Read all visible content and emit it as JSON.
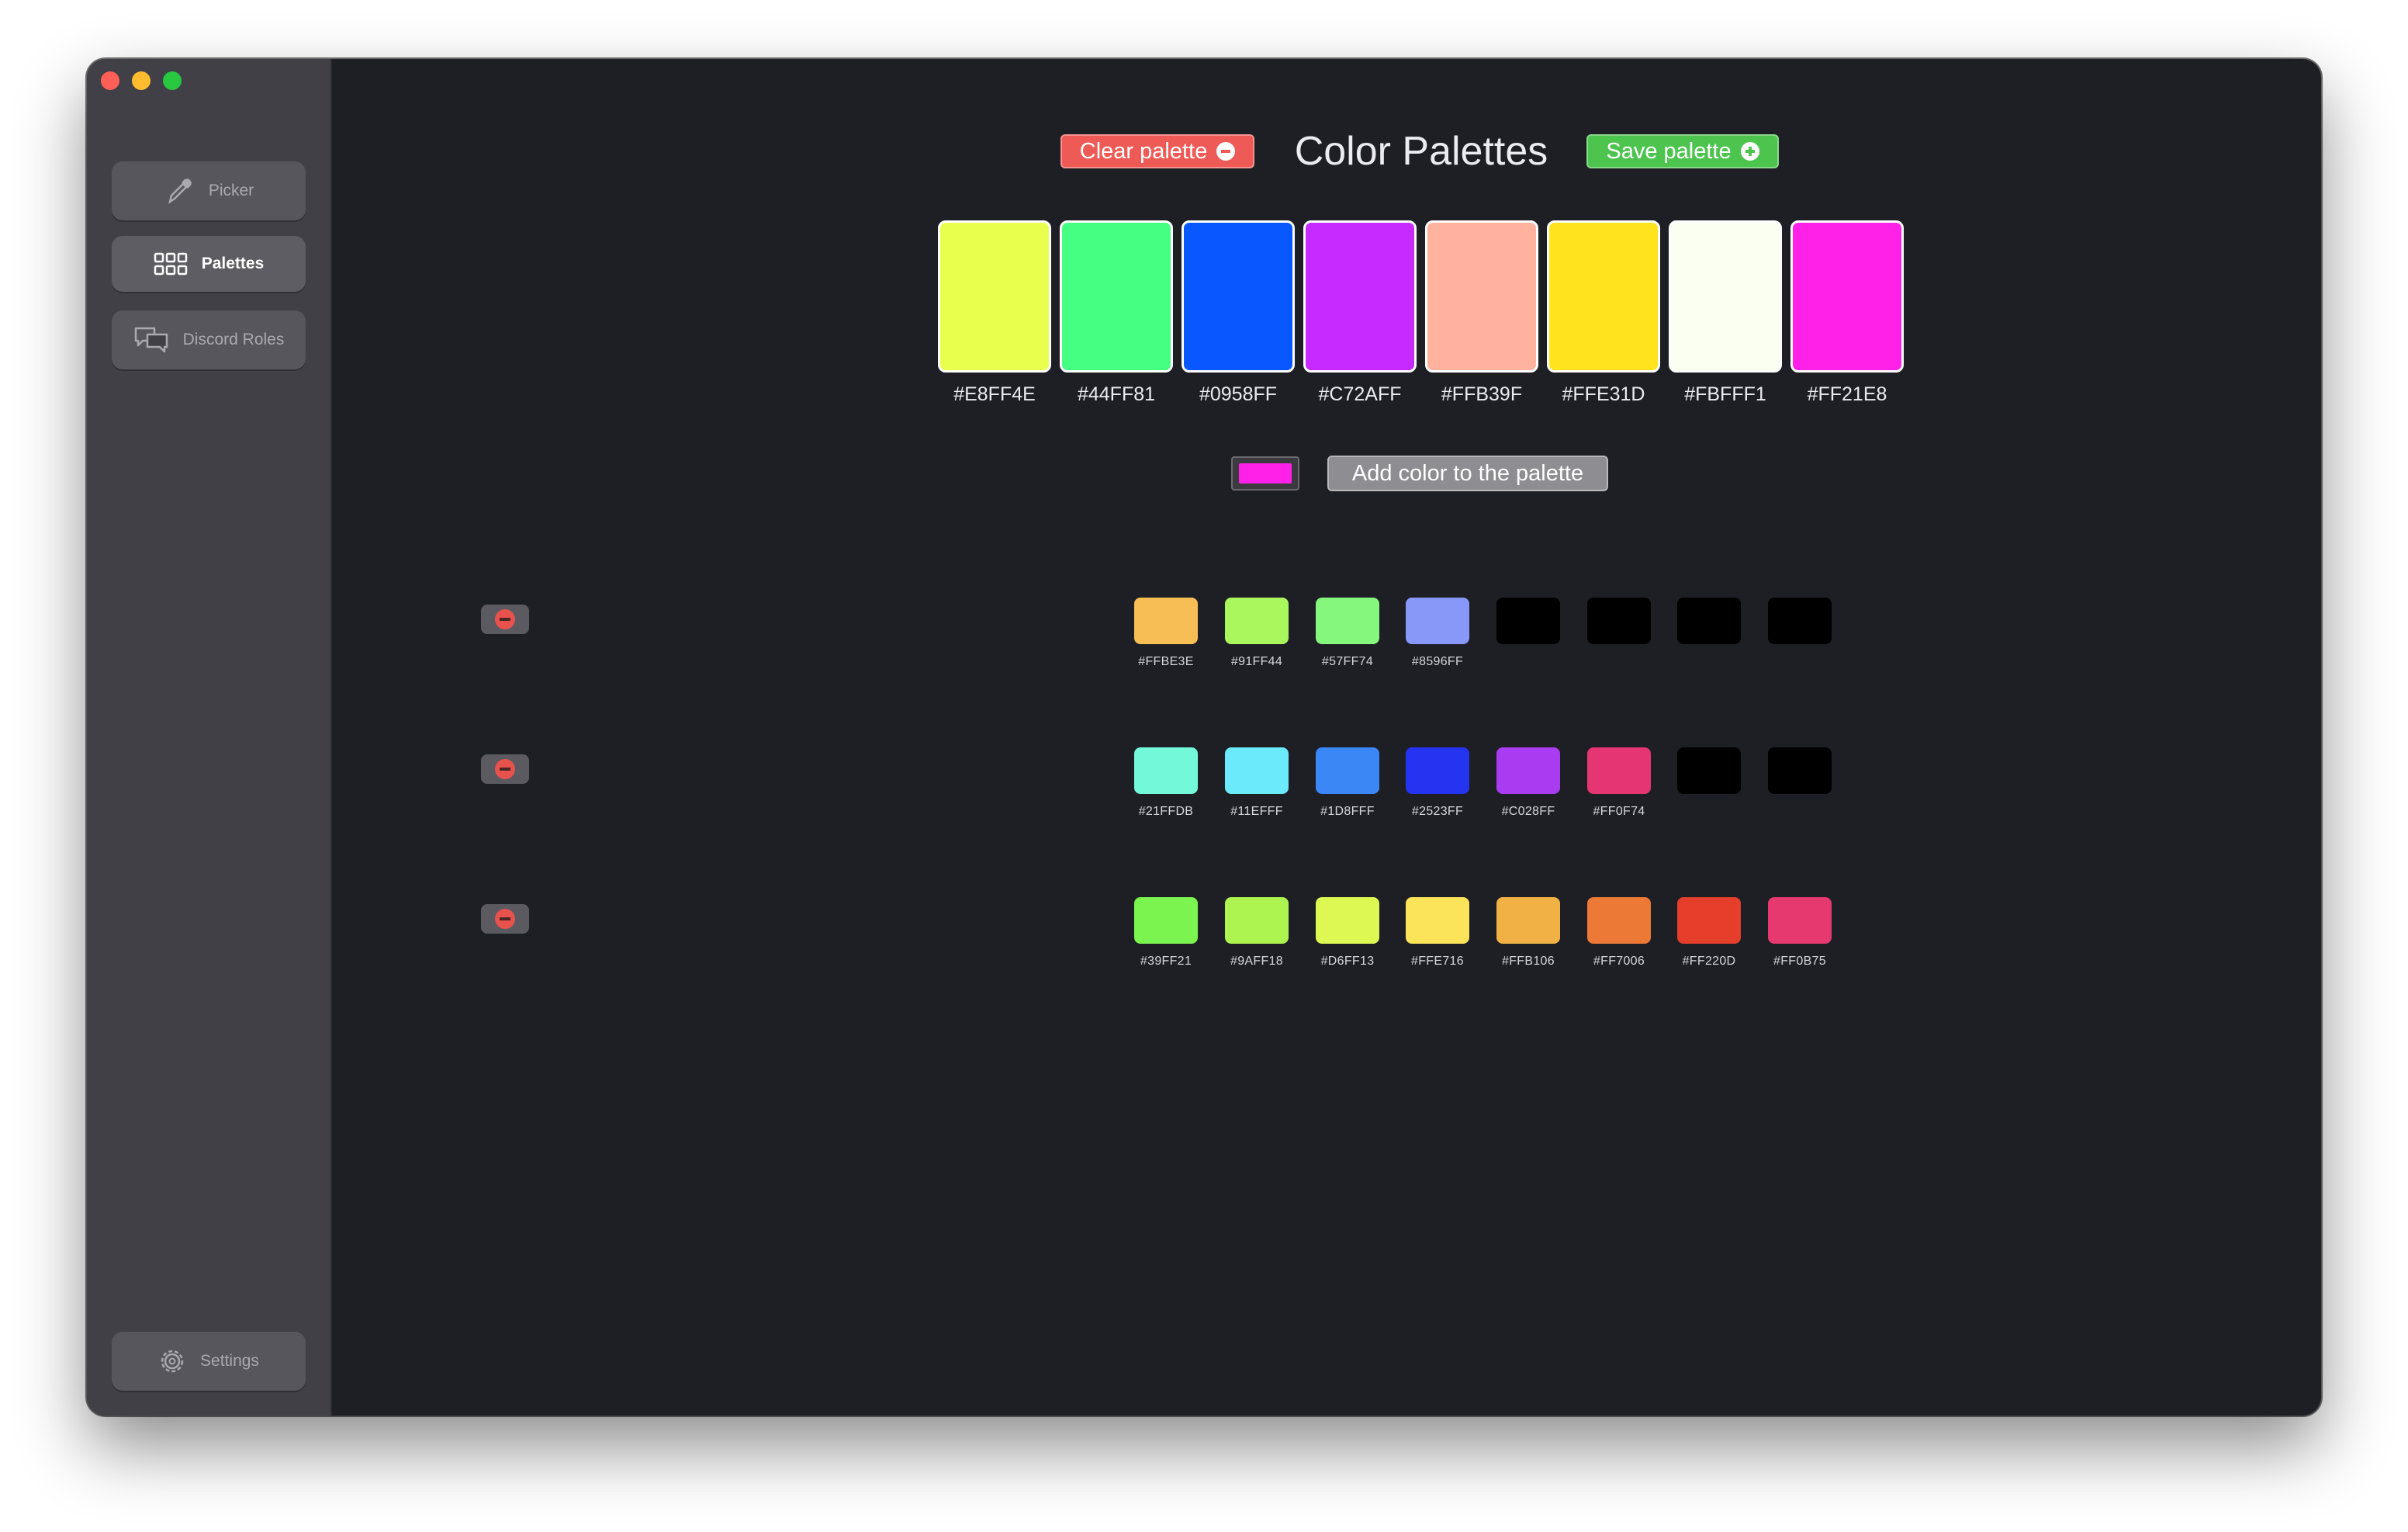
{
  "sidebar": {
    "items": [
      {
        "label": "Picker",
        "icon": "eyedropper-icon"
      },
      {
        "label": "Palettes",
        "icon": "grid-icon"
      },
      {
        "label": "Discord Roles",
        "icon": "chat-bubbles-icon"
      }
    ],
    "settings": {
      "label": "Settings",
      "icon": "gear-icon"
    }
  },
  "header": {
    "title": "Color Palettes",
    "clear_label": "Clear palette",
    "save_label": "Save palette"
  },
  "current_palette": {
    "colors": [
      {
        "hex": "#E8FF4E",
        "color": "#E8FF4E"
      },
      {
        "hex": "#44FF81",
        "color": "#44FF81"
      },
      {
        "hex": "#0958FF",
        "color": "#0958FF"
      },
      {
        "hex": "#C72AFF",
        "color": "#C72AFF"
      },
      {
        "hex": "#FFB39F",
        "color": "#FFB39F"
      },
      {
        "hex": "#FFE31D",
        "color": "#FFE31D"
      },
      {
        "hex": "#FBFFF1",
        "color": "#FBFFF1"
      },
      {
        "hex": "#FF21E8",
        "color": "#FF21E8"
      }
    ]
  },
  "add": {
    "well_color": "#FF21E8",
    "label": "Add color to the palette"
  },
  "saved_palettes": [
    {
      "swatches": [
        {
          "hex": "#FFBE3E",
          "color": "#F6BE55"
        },
        {
          "hex": "#91FF44",
          "color": "#A9F75C"
        },
        {
          "hex": "#57FF74",
          "color": "#85F77C"
        },
        {
          "hex": "#8596FF",
          "color": "#8898F8"
        },
        {
          "hex": "",
          "color": "#000000"
        },
        {
          "hex": "",
          "color": "#000000"
        },
        {
          "hex": "",
          "color": "#000000"
        },
        {
          "hex": "",
          "color": "#000000"
        }
      ]
    },
    {
      "swatches": [
        {
          "hex": "#21FFDB",
          "color": "#74F8DA"
        },
        {
          "hex": "#11EFFF",
          "color": "#6AEAFA"
        },
        {
          "hex": "#1D8FFF",
          "color": "#3B87F5"
        },
        {
          "hex": "#2523FF",
          "color": "#2534F0"
        },
        {
          "hex": "#C028FF",
          "color": "#A93CF0"
        },
        {
          "hex": "#FF0F74",
          "color": "#E63573"
        },
        {
          "hex": "",
          "color": "#000000"
        },
        {
          "hex": "",
          "color": "#000000"
        }
      ]
    },
    {
      "swatches": [
        {
          "hex": "#39FF21",
          "color": "#7CF44F"
        },
        {
          "hex": "#9AFF18",
          "color": "#AEF450"
        },
        {
          "hex": "#D6FF13",
          "color": "#DDF853"
        },
        {
          "hex": "#FFE716",
          "color": "#FBE35A"
        },
        {
          "hex": "#FFB106",
          "color": "#F2B145"
        },
        {
          "hex": "#FF7006",
          "color": "#EC7935"
        },
        {
          "hex": "#FF220D",
          "color": "#E53E2B"
        },
        {
          "hex": "#FF0B75",
          "color": "#E5396F"
        }
      ]
    }
  ]
}
